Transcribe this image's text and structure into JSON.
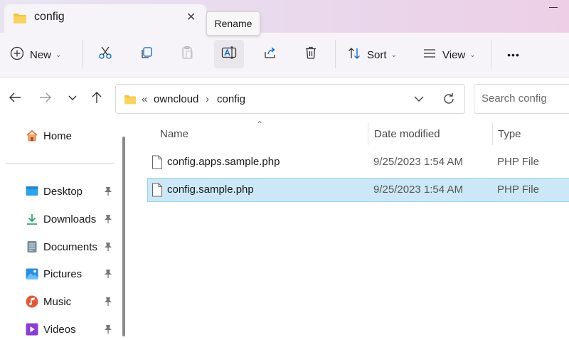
{
  "window": {
    "tab_title": "config",
    "tab_close": "✕"
  },
  "toolbar": {
    "new_label": "New",
    "sort_label": "Sort",
    "view_label": "View",
    "more_label": "•••",
    "tooltip": "Rename",
    "icons": [
      "add-icon",
      "cut-icon",
      "copy-icon",
      "paste-icon",
      "rename-icon",
      "share-icon",
      "delete-icon",
      "sort-icon",
      "view-icon",
      "more-icon"
    ]
  },
  "address": {
    "overflow": "«",
    "crumbs": [
      "owncloud",
      "config"
    ],
    "separator": "›"
  },
  "search": {
    "placeholder": "Search config"
  },
  "sidebar": {
    "home": "Home",
    "items": [
      {
        "label": "Desktop",
        "icon": "desktop-icon"
      },
      {
        "label": "Downloads",
        "icon": "downloads-icon"
      },
      {
        "label": "Documents",
        "icon": "documents-icon"
      },
      {
        "label": "Pictures",
        "icon": "pictures-icon"
      },
      {
        "label": "Music",
        "icon": "music-icon"
      },
      {
        "label": "Videos",
        "icon": "videos-icon"
      }
    ]
  },
  "file_list": {
    "columns": [
      "Name",
      "Date modified",
      "Type"
    ],
    "sort_indicator": "⌃",
    "rows": [
      {
        "name": "config.apps.sample.php",
        "date": "9/25/2023 1:54 AM",
        "type": "PHP File",
        "selected": false
      },
      {
        "name": "config.sample.php",
        "date": "9/25/2023 1:54 AM",
        "type": "PHP File",
        "selected": true
      }
    ]
  },
  "colors": {
    "selection": "#cce8f7",
    "folder": "#f4c542",
    "accent": "#0067c0"
  }
}
